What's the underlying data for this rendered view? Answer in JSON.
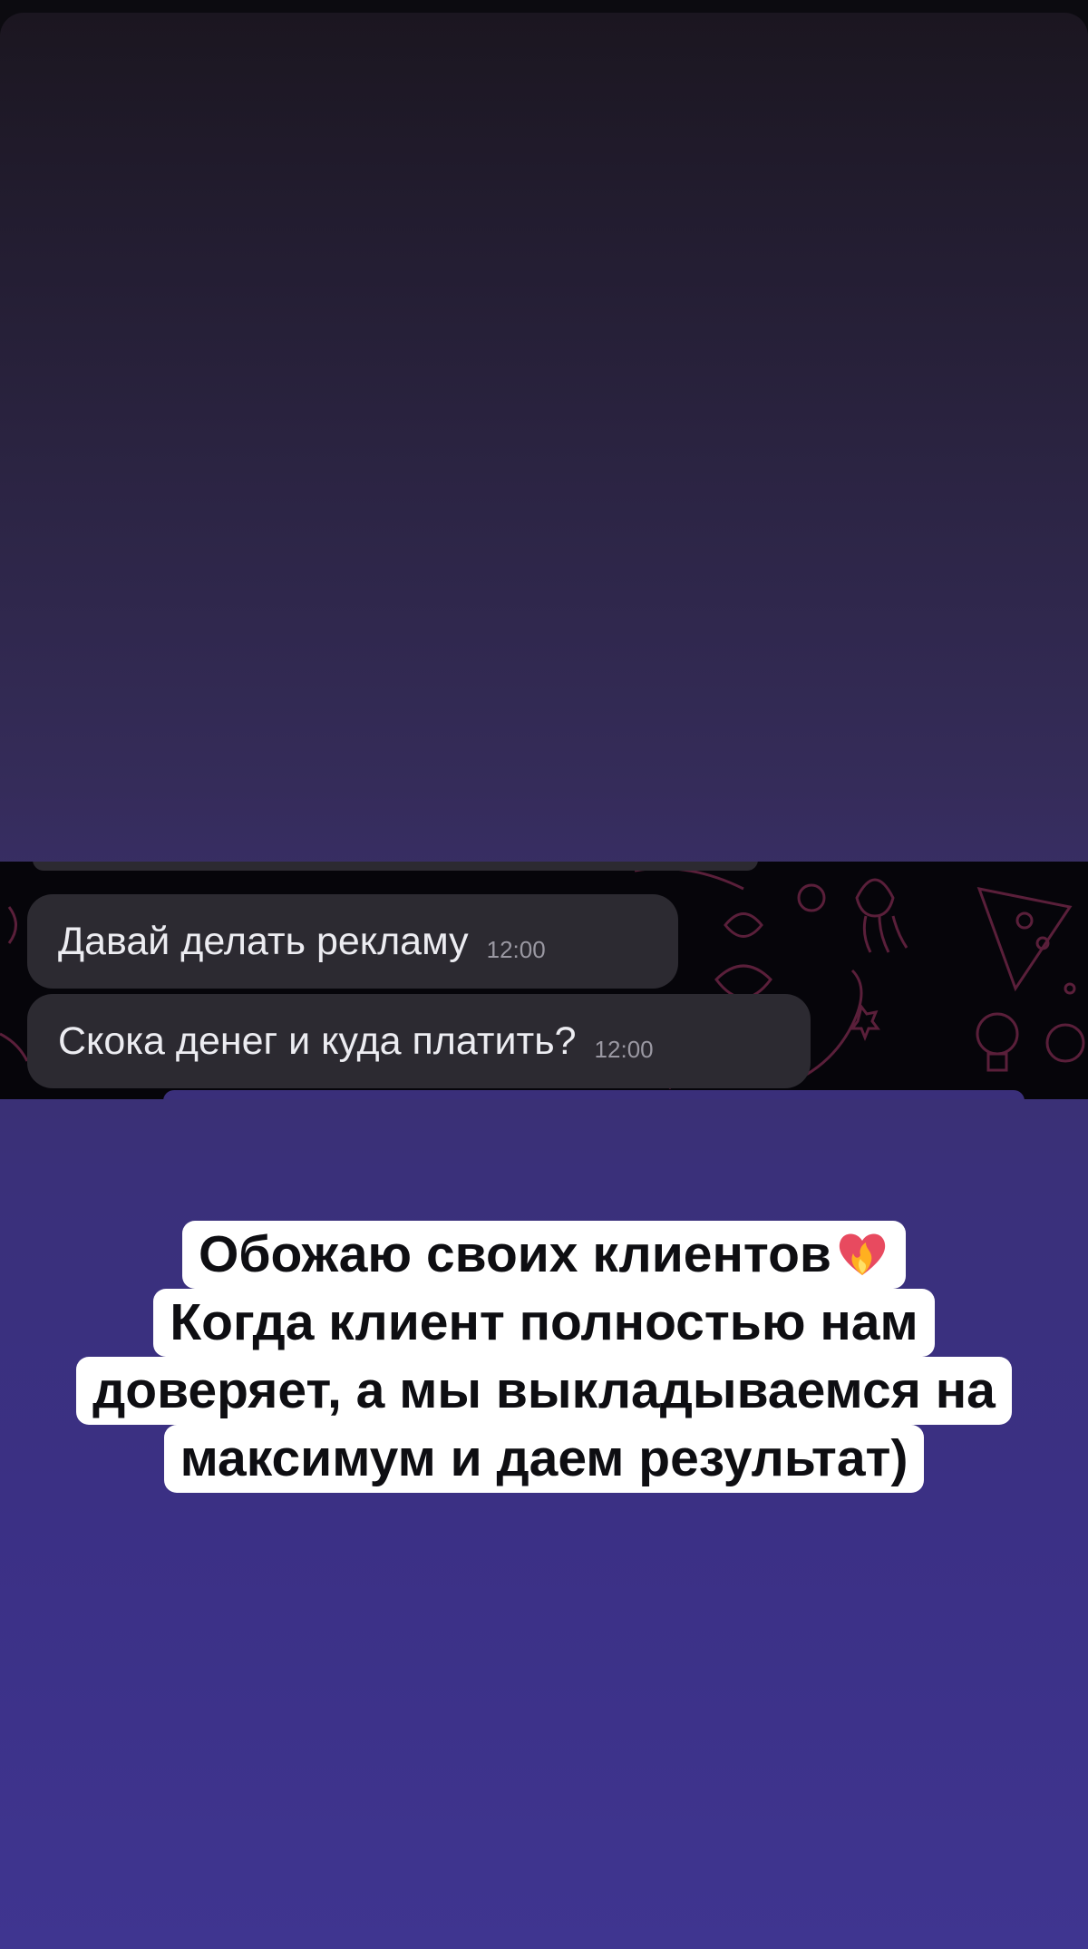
{
  "chat": {
    "messages": [
      {
        "text": "Давай делать рекламу",
        "time": "12:00"
      },
      {
        "text": "Скока денег и куда платить?",
        "time": "12:00"
      }
    ]
  },
  "caption": {
    "lines": [
      "Обожаю своих клиентов",
      "Когда клиент полностью нам",
      "доверяет, а мы выкладываемся на",
      "максимум и даем результат)"
    ],
    "emoji": "heart-on-fire-icon"
  },
  "colors": {
    "bubble": "#2c2a31",
    "chat_bg": "#06050a",
    "gradient_top": "#1b1620",
    "gradient_bottom": "#3f3590",
    "caption_bg": "#ffffff"
  }
}
